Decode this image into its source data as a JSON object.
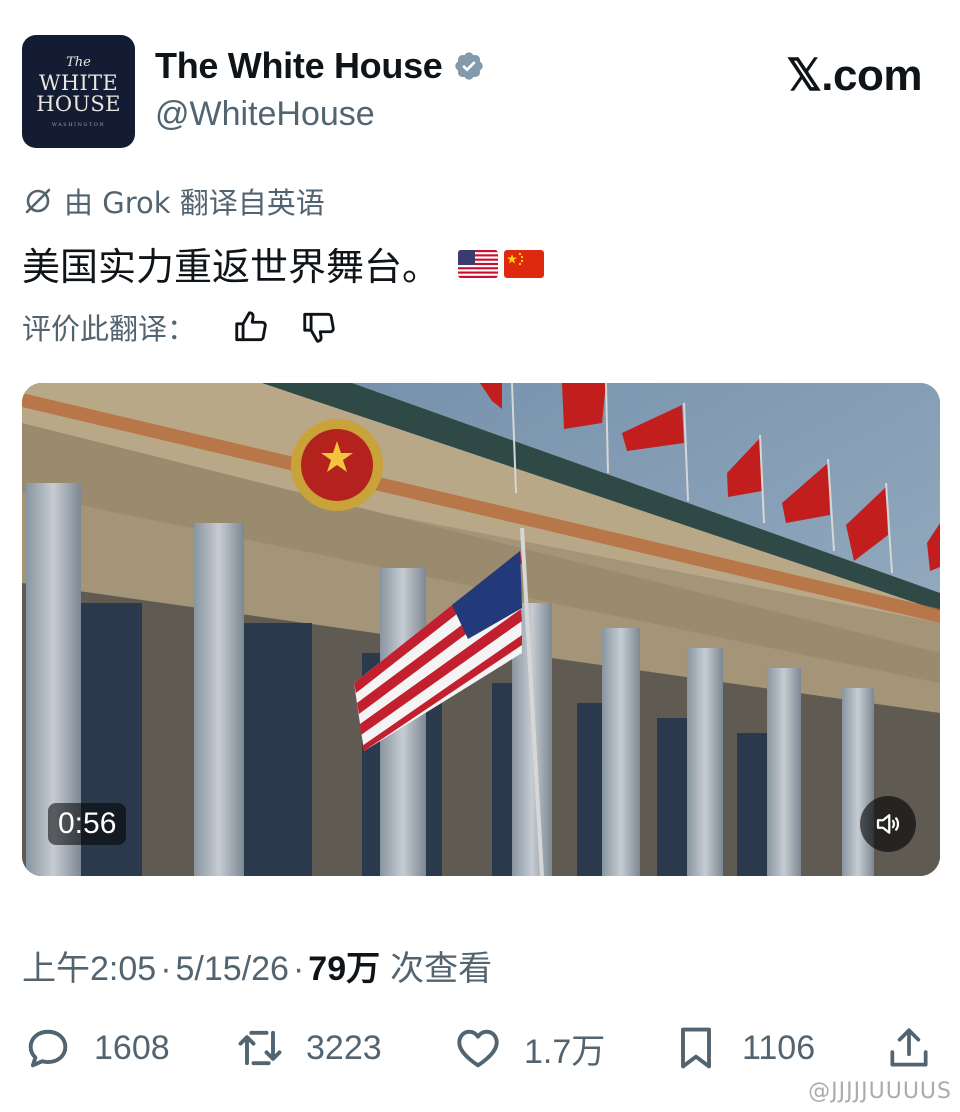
{
  "account": {
    "avatar_line1": "The",
    "avatar_line2": "WHITE",
    "avatar_line3": "HOUSE",
    "avatar_line4": "WASHINGTON",
    "name": "The White House",
    "handle": "@WhiteHouse",
    "verified_icon": "verified-badge-icon",
    "verified_color": "#829aab"
  },
  "brand": {
    "site": "𝕏.com"
  },
  "translation": {
    "label": "由 Grok 翻译自英语",
    "text": "美国实力重返世界舞台。",
    "flags": [
      "us-flag-emoji",
      "china-flag-emoji"
    ],
    "rate_label": "评价此翻译："
  },
  "media": {
    "type": "video",
    "duration": "0:56",
    "mute_icon": "speaker-icon"
  },
  "meta": {
    "time": "上午2:05",
    "sep1": "·",
    "date": "5/15/26",
    "sep2": "·",
    "views": "79万",
    "views_label": "次查看"
  },
  "actions": {
    "replies": "1608",
    "reposts": "3223",
    "likes": "1.7万",
    "bookmarks": "1106"
  },
  "colors": {
    "text_primary": "#0f1419",
    "text_secondary": "#536471",
    "avatar_bg": "#141c33"
  },
  "watermark": "@JJJJJUUUUS"
}
